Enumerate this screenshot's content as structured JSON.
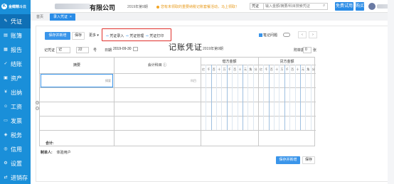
{
  "app": {
    "logo_text": "金蝶精斗云",
    "logo_mark": "K"
  },
  "header": {
    "company_suffix": "有限公司",
    "period": "2019年第9期",
    "notice": "您有未领取的重要纳税记账套餐活动，马上领取！",
    "search_select": "凭证",
    "search_placeholder": "输入金额/摘要/科目搜索凭证",
    "trial_label": "免费试用",
    "buy_label": "购买"
  },
  "tabs": [
    {
      "label": "首页"
    },
    {
      "label": "录入凭证",
      "close": "×"
    }
  ],
  "sidebar": {
    "items": [
      {
        "label": "凭证",
        "icon": "✎"
      },
      {
        "label": "账簿",
        "icon": "▤"
      },
      {
        "label": "报告",
        "icon": "▦"
      },
      {
        "label": "结账",
        "icon": "✓"
      },
      {
        "label": "资产",
        "icon": "▣"
      },
      {
        "label": "出纳",
        "icon": "¥"
      },
      {
        "label": "工资",
        "icon": "☺"
      },
      {
        "label": "发票",
        "icon": "▭"
      },
      {
        "label": "税务",
        "icon": "◈"
      },
      {
        "label": "信用",
        "icon": "◎"
      },
      {
        "label": "设置",
        "icon": "⚙"
      },
      {
        "label": "进销存",
        "icon": "⇄"
      }
    ]
  },
  "toolbar": {
    "save_new": "保存并新增",
    "save": "保存",
    "more": "更多 ▾",
    "actions": [
      {
        "label": "凭证录入",
        "icon": "⇨"
      },
      {
        "label": "凭证管理",
        "icon": "⇨"
      },
      {
        "label": "凭证打印",
        "icon": "⇨"
      }
    ],
    "shortcut_hint": "笔记问题",
    "prev": "‹",
    "next": "›"
  },
  "voucher": {
    "word_label": "记凭证",
    "word_value": "记",
    "number_value": "22",
    "number_unit": "号",
    "date_label": "日期",
    "date_value": "2019-09-30",
    "title": "记账凭证",
    "period": "2019年第9期",
    "attach_label": "附单据",
    "attach_value": "0",
    "attach_unit": "张",
    "col_summary": "摘要",
    "col_subject": "会计科目",
    "col_debit": "借方金额",
    "col_credit": "贷方金额",
    "digits": [
      "亿",
      "千",
      "百",
      "十",
      "万",
      "千",
      "百",
      "十",
      "元",
      "角",
      "分"
    ],
    "summary_ph": "摘要",
    "subject_ph": "科目",
    "total_label": "合计:",
    "maker_label": "制单人:",
    "maker_value": "体验用户"
  },
  "footer": {
    "save_new": "保存并新增",
    "save": "保存"
  }
}
